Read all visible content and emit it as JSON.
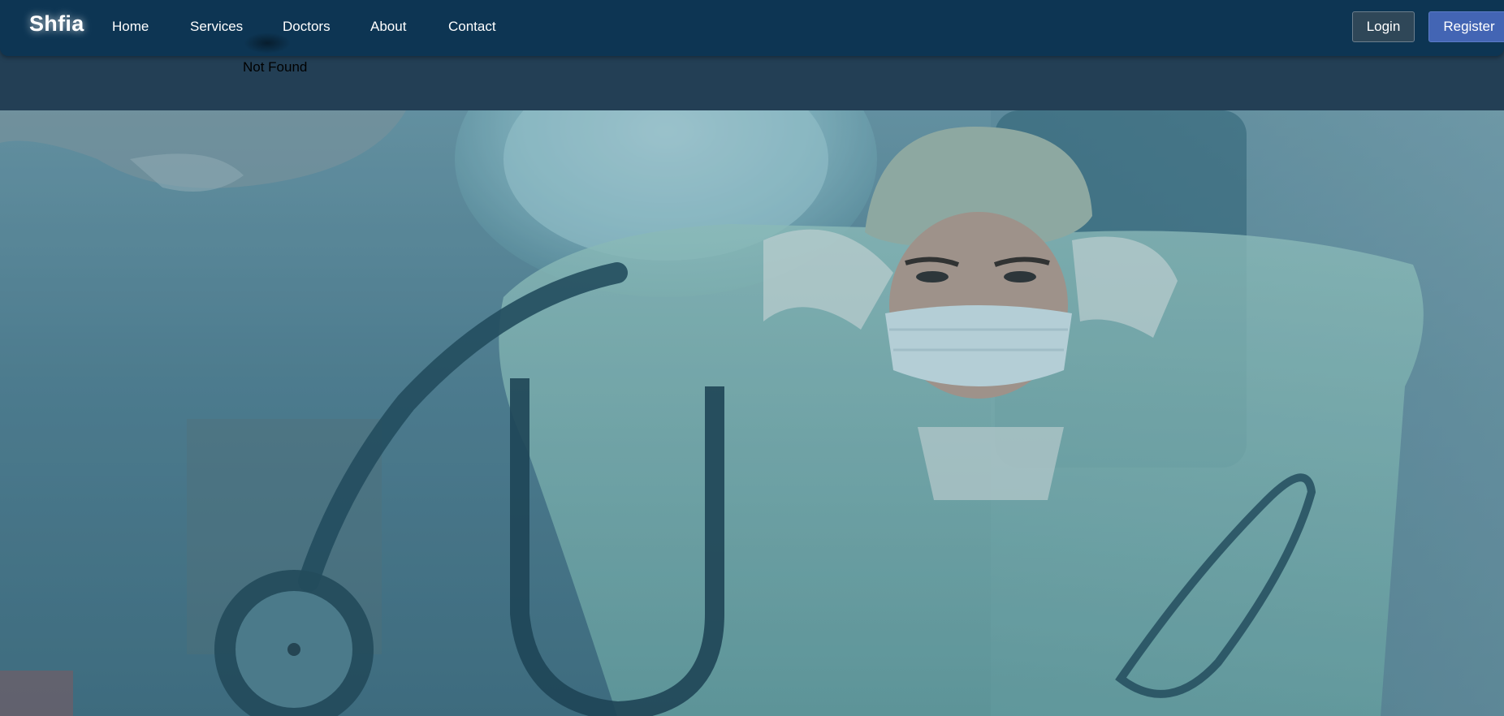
{
  "navbar": {
    "brand": "Shfia",
    "links": [
      "Home",
      "Services",
      "Doctors",
      "About",
      "Contact"
    ],
    "login_label": "Login",
    "register_label": "Register"
  },
  "main": {
    "message": "Not Found"
  },
  "hero": {
    "image_icon": "doctor-photo",
    "colors": {
      "navbar": "#0d3553",
      "band": "#233f55",
      "register": "#4365b4"
    }
  }
}
